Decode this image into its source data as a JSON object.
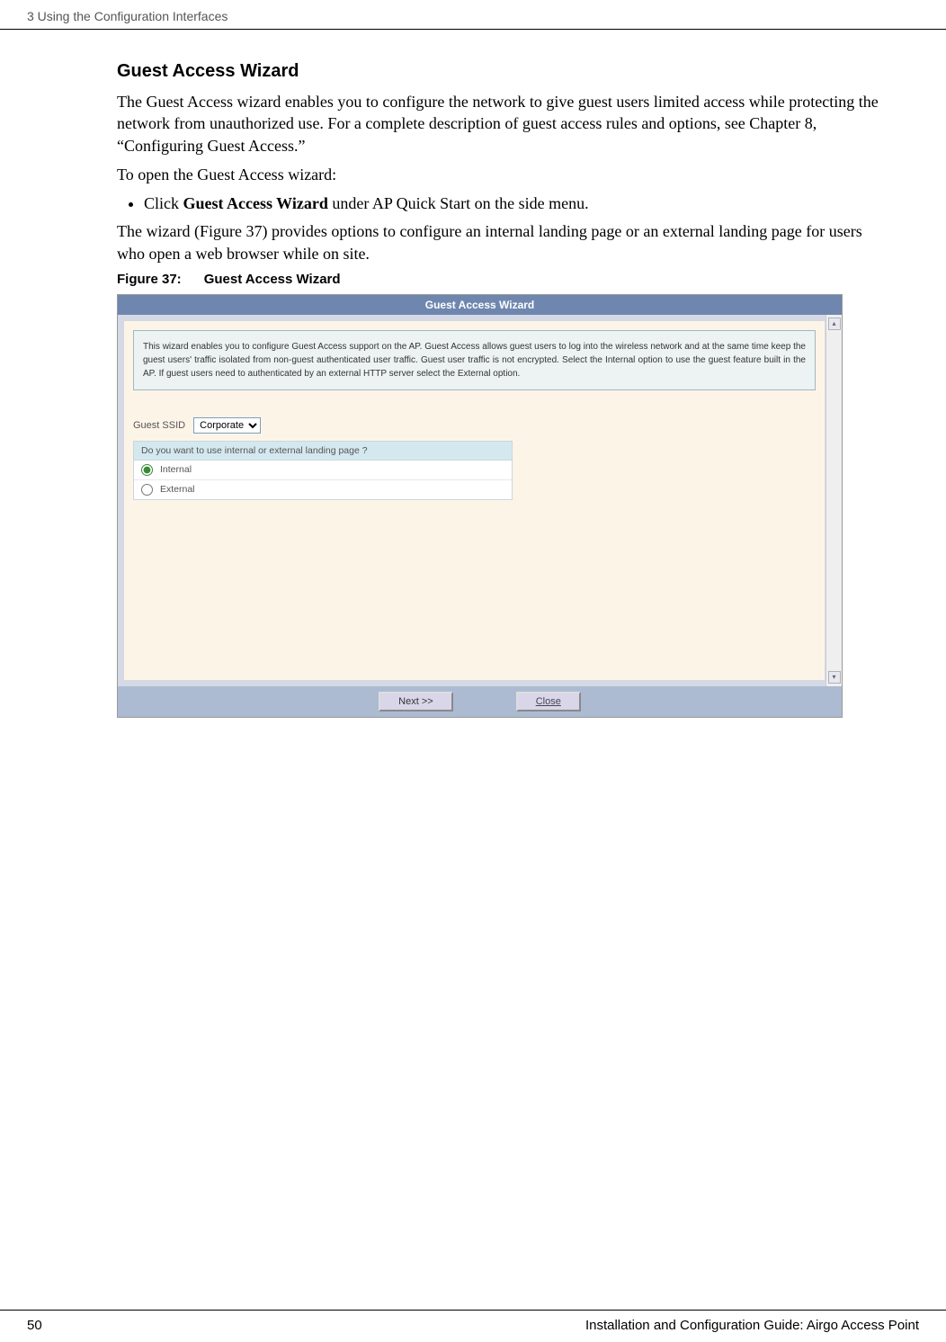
{
  "header": {
    "chapter": "3  Using the Configuration Interfaces"
  },
  "section": {
    "title": "Guest Access Wizard",
    "para1_pre": "The Guest Access wizard enables you to configure the network to give guest users limited access while protecting the network from unauthorized use. For a complete description of guest access rules and options, see Chapter 8,  “Configuring Guest Access.”",
    "para2": "To open the Guest Access wizard:",
    "bullet_pre": "Click ",
    "bullet_bold": "Guest Access Wizard",
    "bullet_post": " under AP Quick Start on the side menu.",
    "para3": "The wizard (Figure 37) provides options to configure an internal landing page or an external landing page for users who open a web browser while on site."
  },
  "figure": {
    "num": "Figure 37:",
    "title": "Guest Access Wizard"
  },
  "wizard": {
    "title": "Guest Access Wizard",
    "description": "This wizard enables you to configure Guest Access support on the AP. Guest Access allows guest users to log into the wireless network and at the same time keep the guest users' traffic isolated from non-guest authenticated user traffic. Guest user traffic is not encrypted. Select the Internal option to use the guest feature built in the AP. If guest users need to authenticated by an external HTTP server select the External option.",
    "ssid_label": "Guest SSID",
    "ssid_value": "Corporate",
    "question": "Do you want to use internal or external landing page ?",
    "option_internal": "Internal",
    "option_external": "External",
    "btn_next": "Next >>",
    "btn_close": "Close"
  },
  "footer": {
    "page": "50",
    "doc": "Installation and Configuration Guide: Airgo Access Point"
  }
}
